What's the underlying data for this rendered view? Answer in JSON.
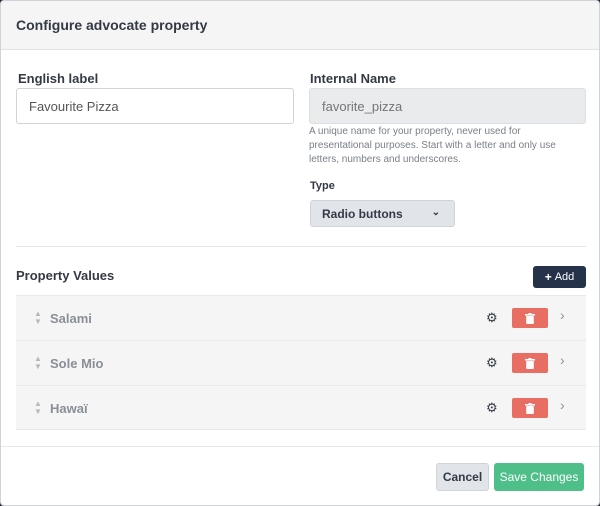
{
  "modal": {
    "title": "Configure advocate property"
  },
  "form": {
    "english_label": {
      "label": "English label",
      "value": "Favourite Pizza"
    },
    "internal_name": {
      "label": "Internal Name",
      "placeholder": "favorite_pizza",
      "help": "A unique name for your property, never used for presentational purposes. Start with a letter and only use letters, numbers and underscores."
    },
    "type": {
      "label": "Type",
      "selected": "Radio buttons"
    }
  },
  "property_values": {
    "title": "Property Values",
    "add_label": "Add",
    "items": [
      {
        "label": "Salami"
      },
      {
        "label": "Sole Mio"
      },
      {
        "label": "Hawaï"
      }
    ]
  },
  "footer": {
    "cancel_label": "Cancel",
    "save_label": "Save Changes"
  },
  "colors": {
    "primary_dark": "#26324a",
    "danger": "#e86d62",
    "success": "#4fbf8a"
  },
  "icons": {
    "gear": "gear-icon",
    "trash": "trash-icon",
    "drag": "drag-handle-icon",
    "chevron_right": "chevron-right-icon",
    "chevron_down": "chevron-down-icon",
    "plus": "plus-icon"
  }
}
